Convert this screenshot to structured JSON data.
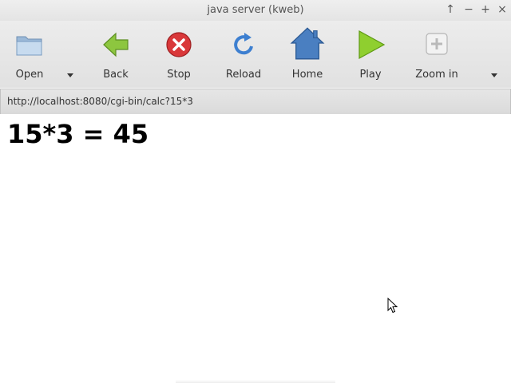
{
  "window": {
    "title": "java server (kweb)",
    "controls": [
      "↑",
      "−",
      "+",
      "×"
    ]
  },
  "toolbar": {
    "open_label": "Open",
    "back_label": "Back",
    "stop_label": "Stop",
    "reload_label": "Reload",
    "home_label": "Home",
    "play_label": "Play",
    "zoom_in_label": "Zoom in"
  },
  "address": {
    "url": "http://localhost:8080/cgi-bin/calc?15*3"
  },
  "page": {
    "result_text": "15*3 = 45"
  },
  "colors": {
    "back_green": "#8dc63f",
    "stop_red": "#d9383a",
    "reload_blue": "#3d7fd0",
    "home_blue": "#4a7fc1",
    "play_green": "#8fcf2f"
  }
}
